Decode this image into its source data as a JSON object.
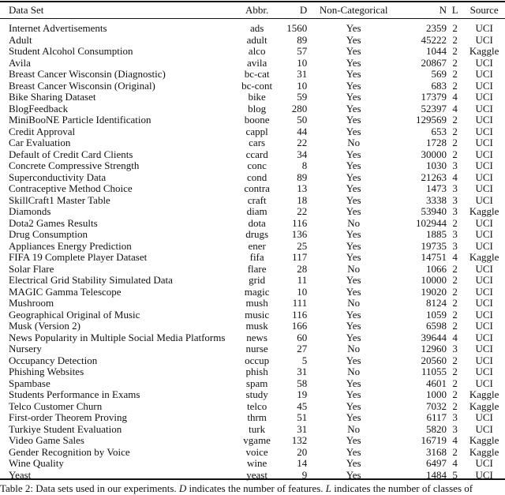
{
  "table": {
    "headers": [
      "Data Set",
      "Abbr.",
      "D",
      "Non-Categorical",
      "N",
      "L",
      "Source"
    ],
    "rows": [
      [
        "Internet Advertisements",
        "ads",
        "1560",
        "Yes",
        "2359",
        "2",
        "UCI"
      ],
      [
        "Adult",
        "adult",
        "89",
        "Yes",
        "45222",
        "2",
        "UCI"
      ],
      [
        "Student Alcohol Consumption",
        "alco",
        "57",
        "Yes",
        "1044",
        "2",
        "Kaggle"
      ],
      [
        "Avila",
        "avila",
        "10",
        "Yes",
        "20867",
        "2",
        "UCI"
      ],
      [
        "Breast Cancer Wisconsin (Diagnostic)",
        "bc-cat",
        "31",
        "Yes",
        "569",
        "2",
        "UCI"
      ],
      [
        "Breast Cancer Wisconsin (Original)",
        "bc-cont",
        "10",
        "Yes",
        "683",
        "2",
        "UCI"
      ],
      [
        "Bike Sharing Dataset",
        "bike",
        "59",
        "Yes",
        "17379",
        "4",
        "UCI"
      ],
      [
        "BlogFeedback",
        "blog",
        "280",
        "Yes",
        "52397",
        "4",
        "UCI"
      ],
      [
        "MiniBooNE Particle Identification",
        "boone",
        "50",
        "Yes",
        "129569",
        "2",
        "UCI"
      ],
      [
        "Credit Approval",
        "cappl",
        "44",
        "Yes",
        "653",
        "2",
        "UCI"
      ],
      [
        "Car Evaluation",
        "cars",
        "22",
        "No",
        "1728",
        "2",
        "UCI"
      ],
      [
        "Default of Credit Card Clients",
        "ccard",
        "34",
        "Yes",
        "30000",
        "2",
        "UCI"
      ],
      [
        "Concrete Compressive Strength",
        "conc",
        "8",
        "Yes",
        "1030",
        "3",
        "UCI"
      ],
      [
        "Superconductivity Data",
        "cond",
        "89",
        "Yes",
        "21263",
        "4",
        "UCI"
      ],
      [
        "Contraceptive Method Choice",
        "contra",
        "13",
        "Yes",
        "1473",
        "3",
        "UCI"
      ],
      [
        "SkillCraft1 Master Table",
        "craft",
        "18",
        "Yes",
        "3338",
        "3",
        "UCI"
      ],
      [
        "Diamonds",
        "diam",
        "22",
        "Yes",
        "53940",
        "3",
        "Kaggle"
      ],
      [
        "Dota2 Games Results",
        "dota",
        "116",
        "No",
        "102944",
        "2",
        "UCI"
      ],
      [
        "Drug Consumption",
        "drugs",
        "136",
        "Yes",
        "1885",
        "3",
        "UCI"
      ],
      [
        "Appliances Energy Prediction",
        "ener",
        "25",
        "Yes",
        "19735",
        "3",
        "UCI"
      ],
      [
        "FIFA 19 Complete Player Dataset",
        "fifa",
        "117",
        "Yes",
        "14751",
        "4",
        "Kaggle"
      ],
      [
        "Solar Flare",
        "flare",
        "28",
        "No",
        "1066",
        "2",
        "UCI"
      ],
      [
        "Electrical Grid Stability Simulated Data",
        "grid",
        "11",
        "Yes",
        "10000",
        "2",
        "UCI"
      ],
      [
        "MAGIC Gamma Telescope",
        "magic",
        "10",
        "Yes",
        "19020",
        "2",
        "UCI"
      ],
      [
        "Mushroom",
        "mush",
        "111",
        "No",
        "8124",
        "2",
        "UCI"
      ],
      [
        "Geographical Original of Music",
        "music",
        "116",
        "Yes",
        "1059",
        "2",
        "UCI"
      ],
      [
        "Musk (Version 2)",
        "musk",
        "166",
        "Yes",
        "6598",
        "2",
        "UCI"
      ],
      [
        "News Popularity in Multiple Social Media Platforms",
        "news",
        "60",
        "Yes",
        "39644",
        "4",
        "UCI"
      ],
      [
        "Nursery",
        "nurse",
        "27",
        "No",
        "12960",
        "3",
        "UCI"
      ],
      [
        "Occupancy Detection",
        "occup",
        "5",
        "Yes",
        "20560",
        "2",
        "UCI"
      ],
      [
        "Phishing Websites",
        "phish",
        "31",
        "No",
        "11055",
        "2",
        "UCI"
      ],
      [
        "Spambase",
        "spam",
        "58",
        "Yes",
        "4601",
        "2",
        "UCI"
      ],
      [
        "Students Performance in Exams",
        "study",
        "19",
        "Yes",
        "1000",
        "2",
        "Kaggle"
      ],
      [
        "Telco Customer Churn",
        "telco",
        "45",
        "Yes",
        "7032",
        "2",
        "Kaggle"
      ],
      [
        "First-order Theorem Proving",
        "thrm",
        "51",
        "Yes",
        "6117",
        "3",
        "UCI"
      ],
      [
        "Turkiye Student Evaluation",
        "turk",
        "31",
        "No",
        "5820",
        "3",
        "UCI"
      ],
      [
        "Video Game Sales",
        "vgame",
        "132",
        "Yes",
        "16719",
        "4",
        "Kaggle"
      ],
      [
        "Gender Recognition by Voice",
        "voice",
        "20",
        "Yes",
        "3168",
        "2",
        "Kaggle"
      ],
      [
        "Wine Quality",
        "wine",
        "14",
        "Yes",
        "6497",
        "4",
        "UCI"
      ],
      [
        "Yeast",
        "yeast",
        "9",
        "Yes",
        "1484",
        "5",
        "UCI"
      ]
    ]
  },
  "caption": {
    "prefix": "Table 2: Data sets used in our experiments. ",
    "var_d": "D",
    "mid": " indicates the number of features. ",
    "var_l": "L",
    "suffix": " indicates the number of classes of"
  }
}
